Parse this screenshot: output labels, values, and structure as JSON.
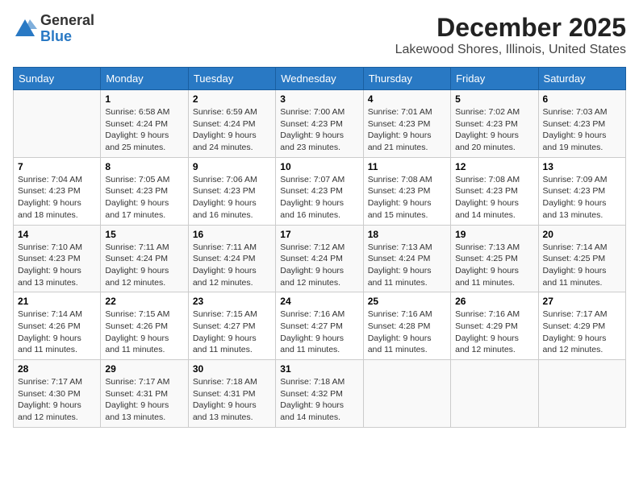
{
  "logo": {
    "general": "General",
    "blue": "Blue"
  },
  "title": "December 2025",
  "subtitle": "Lakewood Shores, Illinois, United States",
  "days_of_week": [
    "Sunday",
    "Monday",
    "Tuesday",
    "Wednesday",
    "Thursday",
    "Friday",
    "Saturday"
  ],
  "weeks": [
    [
      {
        "day": "",
        "info": ""
      },
      {
        "day": "1",
        "info": "Sunrise: 6:58 AM\nSunset: 4:24 PM\nDaylight: 9 hours\nand 25 minutes."
      },
      {
        "day": "2",
        "info": "Sunrise: 6:59 AM\nSunset: 4:24 PM\nDaylight: 9 hours\nand 24 minutes."
      },
      {
        "day": "3",
        "info": "Sunrise: 7:00 AM\nSunset: 4:23 PM\nDaylight: 9 hours\nand 23 minutes."
      },
      {
        "day": "4",
        "info": "Sunrise: 7:01 AM\nSunset: 4:23 PM\nDaylight: 9 hours\nand 21 minutes."
      },
      {
        "day": "5",
        "info": "Sunrise: 7:02 AM\nSunset: 4:23 PM\nDaylight: 9 hours\nand 20 minutes."
      },
      {
        "day": "6",
        "info": "Sunrise: 7:03 AM\nSunset: 4:23 PM\nDaylight: 9 hours\nand 19 minutes."
      }
    ],
    [
      {
        "day": "7",
        "info": "Sunrise: 7:04 AM\nSunset: 4:23 PM\nDaylight: 9 hours\nand 18 minutes."
      },
      {
        "day": "8",
        "info": "Sunrise: 7:05 AM\nSunset: 4:23 PM\nDaylight: 9 hours\nand 17 minutes."
      },
      {
        "day": "9",
        "info": "Sunrise: 7:06 AM\nSunset: 4:23 PM\nDaylight: 9 hours\nand 16 minutes."
      },
      {
        "day": "10",
        "info": "Sunrise: 7:07 AM\nSunset: 4:23 PM\nDaylight: 9 hours\nand 16 minutes."
      },
      {
        "day": "11",
        "info": "Sunrise: 7:08 AM\nSunset: 4:23 PM\nDaylight: 9 hours\nand 15 minutes."
      },
      {
        "day": "12",
        "info": "Sunrise: 7:08 AM\nSunset: 4:23 PM\nDaylight: 9 hours\nand 14 minutes."
      },
      {
        "day": "13",
        "info": "Sunrise: 7:09 AM\nSunset: 4:23 PM\nDaylight: 9 hours\nand 13 minutes."
      }
    ],
    [
      {
        "day": "14",
        "info": "Sunrise: 7:10 AM\nSunset: 4:23 PM\nDaylight: 9 hours\nand 13 minutes."
      },
      {
        "day": "15",
        "info": "Sunrise: 7:11 AM\nSunset: 4:24 PM\nDaylight: 9 hours\nand 12 minutes."
      },
      {
        "day": "16",
        "info": "Sunrise: 7:11 AM\nSunset: 4:24 PM\nDaylight: 9 hours\nand 12 minutes."
      },
      {
        "day": "17",
        "info": "Sunrise: 7:12 AM\nSunset: 4:24 PM\nDaylight: 9 hours\nand 12 minutes."
      },
      {
        "day": "18",
        "info": "Sunrise: 7:13 AM\nSunset: 4:24 PM\nDaylight: 9 hours\nand 11 minutes."
      },
      {
        "day": "19",
        "info": "Sunrise: 7:13 AM\nSunset: 4:25 PM\nDaylight: 9 hours\nand 11 minutes."
      },
      {
        "day": "20",
        "info": "Sunrise: 7:14 AM\nSunset: 4:25 PM\nDaylight: 9 hours\nand 11 minutes."
      }
    ],
    [
      {
        "day": "21",
        "info": "Sunrise: 7:14 AM\nSunset: 4:26 PM\nDaylight: 9 hours\nand 11 minutes."
      },
      {
        "day": "22",
        "info": "Sunrise: 7:15 AM\nSunset: 4:26 PM\nDaylight: 9 hours\nand 11 minutes."
      },
      {
        "day": "23",
        "info": "Sunrise: 7:15 AM\nSunset: 4:27 PM\nDaylight: 9 hours\nand 11 minutes."
      },
      {
        "day": "24",
        "info": "Sunrise: 7:16 AM\nSunset: 4:27 PM\nDaylight: 9 hours\nand 11 minutes."
      },
      {
        "day": "25",
        "info": "Sunrise: 7:16 AM\nSunset: 4:28 PM\nDaylight: 9 hours\nand 11 minutes."
      },
      {
        "day": "26",
        "info": "Sunrise: 7:16 AM\nSunset: 4:29 PM\nDaylight: 9 hours\nand 12 minutes."
      },
      {
        "day": "27",
        "info": "Sunrise: 7:17 AM\nSunset: 4:29 PM\nDaylight: 9 hours\nand 12 minutes."
      }
    ],
    [
      {
        "day": "28",
        "info": "Sunrise: 7:17 AM\nSunset: 4:30 PM\nDaylight: 9 hours\nand 12 minutes."
      },
      {
        "day": "29",
        "info": "Sunrise: 7:17 AM\nSunset: 4:31 PM\nDaylight: 9 hours\nand 13 minutes."
      },
      {
        "day": "30",
        "info": "Sunrise: 7:18 AM\nSunset: 4:31 PM\nDaylight: 9 hours\nand 13 minutes."
      },
      {
        "day": "31",
        "info": "Sunrise: 7:18 AM\nSunset: 4:32 PM\nDaylight: 9 hours\nand 14 minutes."
      },
      {
        "day": "",
        "info": ""
      },
      {
        "day": "",
        "info": ""
      },
      {
        "day": "",
        "info": ""
      }
    ]
  ]
}
